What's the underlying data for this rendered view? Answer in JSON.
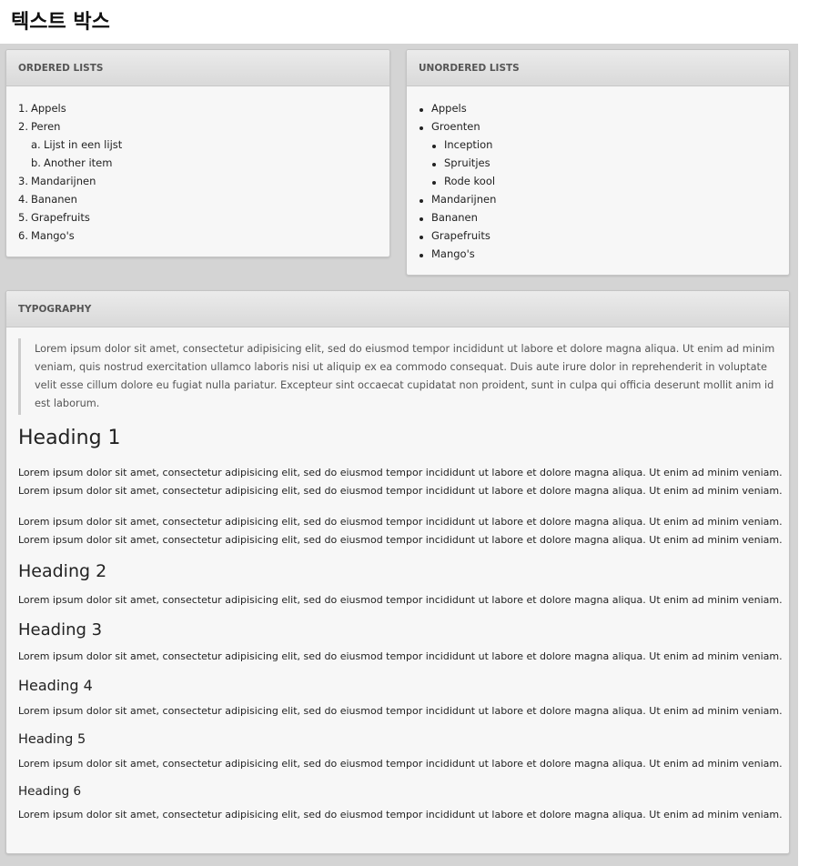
{
  "page": {
    "title": "텍스트 박스"
  },
  "ordered_panel": {
    "header": "ORDERED LISTS",
    "items": [
      {
        "marker": "1.",
        "label": "Appels"
      },
      {
        "marker": "2.",
        "label": "Peren"
      },
      {
        "marker": "a.",
        "label": "Lijst in een lijst"
      },
      {
        "marker": "b.",
        "label": "Another item"
      },
      {
        "marker": "3.",
        "label": "Mandarijnen"
      },
      {
        "marker": "4.",
        "label": "Bananen"
      },
      {
        "marker": "5.",
        "label": "Grapefruits"
      },
      {
        "marker": "6.",
        "label": "Mango's"
      }
    ]
  },
  "unordered_panel": {
    "header": "UNORDERED LISTS",
    "items": [
      {
        "label": "Appels"
      },
      {
        "label": "Groenten"
      },
      {
        "label": "Inception"
      },
      {
        "label": "Spruitjes"
      },
      {
        "label": "Rode kool"
      },
      {
        "label": "Mandarijnen"
      },
      {
        "label": "Bananen"
      },
      {
        "label": "Grapefruits"
      },
      {
        "label": "Mango's"
      }
    ]
  },
  "typography_panel": {
    "header": "TYPOGRAPHY",
    "blockquote": "Lorem ipsum dolor sit amet, consectetur adipisicing elit, sed do eiusmod tempor incididunt ut labore et dolore magna aliqua. Ut enim ad minim veniam, quis nostrud exercitation ullamco laboris nisi ut aliquip ex ea commodo consequat. Duis aute irure dolor in reprehenderit in voluptate velit esse cillum dolore eu fugiat nulla pariatur. Excepteur sint occaecat cupidatat non proident, sunt in culpa qui officia deserunt mollit anim id est laborum.",
    "lorem_line": "Lorem ipsum dolor sit amet, consectetur adipisicing elit, sed do eiusmod tempor incididunt ut labore et dolore magna aliqua. Ut enim ad minim veniam.",
    "headings": {
      "h1": "Heading 1",
      "h2": "Heading 2",
      "h3": "Heading 3",
      "h4": "Heading 4",
      "h5": "Heading 5",
      "h6": "Heading 6"
    },
    "paragraphs": {
      "p1_line1": "Lorem ipsum dolor sit amet, consectetur adipisicing elit, sed do eiusmod tempor incididunt ut labore et dolore magna aliqua. Ut enim ad minim veniam.",
      "p1_line2": "Lorem ipsum dolor sit amet, consectetur adipisicing elit, sed do eiusmod tempor incididunt ut labore et dolore magna aliqua. Ut enim ad minim veniam.",
      "p2_line1": "Lorem ipsum dolor sit amet, consectetur adipisicing elit, sed do eiusmod tempor incididunt ut labore et dolore magna aliqua. Ut enim ad minim veniam.",
      "p2_line2": "Lorem ipsum dolor sit amet, consectetur adipisicing elit, sed do eiusmod tempor incididunt ut labore et dolore magna aliqua. Ut enim ad minim veniam.",
      "after_h2": "Lorem ipsum dolor sit amet, consectetur adipisicing elit, sed do eiusmod tempor incididunt ut labore et dolore magna aliqua. Ut enim ad minim veniam.",
      "after_h3": "Lorem ipsum dolor sit amet, consectetur adipisicing elit, sed do eiusmod tempor incididunt ut labore et dolore magna aliqua. Ut enim ad minim veniam.",
      "after_h4": "Lorem ipsum dolor sit amet, consectetur adipisicing elit, sed do eiusmod tempor incididunt ut labore et dolore magna aliqua. Ut enim ad minim veniam.",
      "after_h5": "Lorem ipsum dolor sit amet, consectetur adipisicing elit, sed do eiusmod tempor incididunt ut labore et dolore magna aliqua. Ut enim ad minim veniam.",
      "after_h6": "Lorem ipsum dolor sit amet, consectetur adipisicing elit, sed do eiusmod tempor incididunt ut labore et dolore magna aliqua. Ut enim ad minim veniam."
    }
  }
}
